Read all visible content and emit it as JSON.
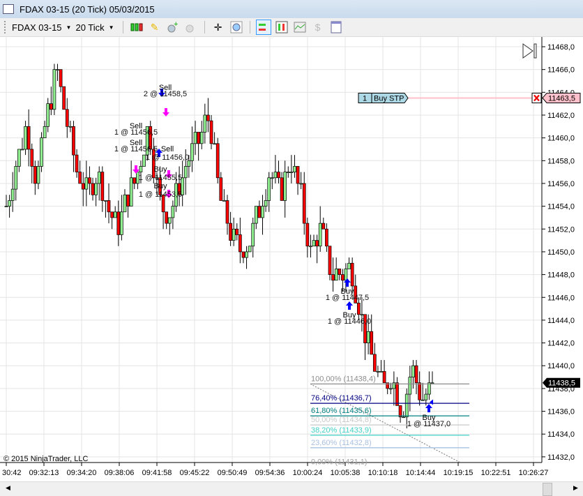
{
  "window": {
    "title": "FDAX 03-15 (20 Tick)  05/03/2015"
  },
  "toolbar": {
    "instrument": "FDAX 03-15",
    "interval": "20 Tick",
    "icons": [
      "candlestick-style-icon",
      "pencil-draw-icon",
      "zoom-in-icon",
      "zoom-out-icon",
      "crosshair-icon",
      "magnifier-icon",
      "chart-trader-icon",
      "bar-chart-icon",
      "indicators-icon",
      "strategies-icon",
      "properties-icon"
    ]
  },
  "price_axis": {
    "ticks": [
      "11468,0",
      "11466,0",
      "11464,0",
      "11462,0",
      "11460,0",
      "11458,0",
      "11456,0",
      "11454,0",
      "11452,0",
      "11450,0",
      "11448,0",
      "11446,0",
      "11444,0",
      "11442,0",
      "11440,0",
      "11438,0",
      "11436,0",
      "11434,0",
      "11432,0"
    ],
    "last_price": "11438,5",
    "order_price": "11463,5"
  },
  "time_axis": {
    "ticks": [
      "30:42",
      "09:32:13",
      "09:34:20",
      "09:38:06",
      "09:41:58",
      "09:45:22",
      "09:50:49",
      "09:54:36",
      "10:00:24",
      "10:05:38",
      "10:10:18",
      "10:14:44",
      "10:19:15",
      "10:22:51",
      "10:26:27"
    ]
  },
  "order": {
    "qty": "1",
    "type": "Buy STP"
  },
  "fib": [
    {
      "label": "100,00% (11438,4)",
      "color": "#8c8c8c",
      "price": 11438.4
    },
    {
      "label": "76,40% (11436,7)",
      "color": "#000080",
      "price": 11436.7
    },
    {
      "label": "61,80% (11435,6)",
      "color": "#008080",
      "price": 11435.6
    },
    {
      "label": "50,00% (11434,8)",
      "color": "#c8c8c8",
      "price": 11434.8
    },
    {
      "label": "38,20% (11433,9)",
      "color": "#40d0c8",
      "price": 11433.9
    },
    {
      "label": "23,60% (11432,8)",
      "color": "#a8c0e0",
      "price": 11432.8
    },
    {
      "label": "0,00% (11431,1)",
      "color": "#a0a0a0",
      "price": 11431.1
    }
  ],
  "executions": [
    {
      "side": "Sell",
      "text": "2 @ 11458,5"
    },
    {
      "side": "Sell",
      "text": "1 @ 11456,5"
    },
    {
      "side": "Sell",
      "text": "1 @ 11456,5"
    },
    {
      "side": "Sell",
      "text": "1 @ 11456,0"
    },
    {
      "side": "Buy",
      "text": "1 @ 11455,5"
    },
    {
      "side": "Buy",
      "text": "1 @ 11453,5"
    },
    {
      "side": "Buy",
      "text": "1 @ 11447,5"
    },
    {
      "side": "Buy",
      "text": "1 @ 11446,0"
    },
    {
      "side": "Buy",
      "text": "1 @ 11437,0"
    }
  ],
  "copyright": "© 2015 NinjaTrader, LLC",
  "colors": {
    "up": "#90ee90",
    "down": "#ff0000",
    "grid": "#e4e4e4",
    "order_line": "#ffc0cb"
  },
  "price_path": [
    11454,
    11458,
    11461,
    11456,
    11462,
    11466,
    11461,
    11457,
    11455,
    11457,
    11454,
    11452,
    11455,
    11457,
    11461,
    11455,
    11453,
    11456,
    11458,
    11460,
    11462,
    11455,
    11452,
    11450,
    11451,
    11454,
    11457,
    11455,
    11458,
    11455,
    11450,
    11452,
    11448,
    11448,
    11449,
    11444,
    11441,
    11438,
    11439,
    11436,
    11440,
    11437,
    11438.5
  ]
}
